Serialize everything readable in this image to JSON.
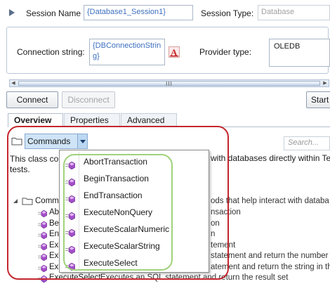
{
  "header": {
    "session_name_label": "Session Name",
    "session_name_value": "{Database1_Session1}",
    "session_type_label": "Session Type:",
    "session_type_value": "Database"
  },
  "connection": {
    "label": "Connection string:",
    "value_line1": "{DBConnectionStrin",
    "value_line2": "g}",
    "provider_label": "Provider type:",
    "provider_value": "OLEDB"
  },
  "scrollbar": {
    "grip": "III"
  },
  "buttons": {
    "connect": "Connect",
    "disconnect": "Disconnect",
    "start": "Start"
  },
  "tabs": [
    {
      "label": "Overview",
      "active": true
    },
    {
      "label": "Properties",
      "active": false
    },
    {
      "label": "Advanced",
      "active": false
    }
  ],
  "toolbar": {
    "commands_label": "Commands",
    "search_placeholder": "Search..."
  },
  "description": {
    "line1_start": "This class con",
    "line1_end": "with databases directly within Te",
    "line2": "tests."
  },
  "tree": {
    "root_label": "Comm",
    "root_desc": "ods that help interact with databa",
    "rows": [
      {
        "label": "Abo",
        "desc": "nsaction"
      },
      {
        "label": "Beg",
        "desc": "on"
      },
      {
        "label": "End",
        "desc": "n"
      },
      {
        "label": "Exe",
        "desc": "tement"
      },
      {
        "label": "Exe",
        "desc": "statement and return the number"
      },
      {
        "label": "Exe",
        "desc": "atement and return the string in th"
      },
      {
        "label": "ExecuteSelect",
        "desc": "Executes an SQL statement and return the result set"
      }
    ]
  },
  "dropdown": {
    "items": [
      "AbortTransaction",
      "BeginTransaction",
      "EndTransaction",
      "ExecuteNonQuery",
      "ExecuteScalarNumeric",
      "ExecuteScalarString",
      "ExecuteSelect"
    ]
  },
  "colors": {
    "highlight_red": "#c4262e",
    "highlight_green": "#9fd27a",
    "method_icon": "#a24fc8",
    "link_blue": "#3c6fbe"
  }
}
